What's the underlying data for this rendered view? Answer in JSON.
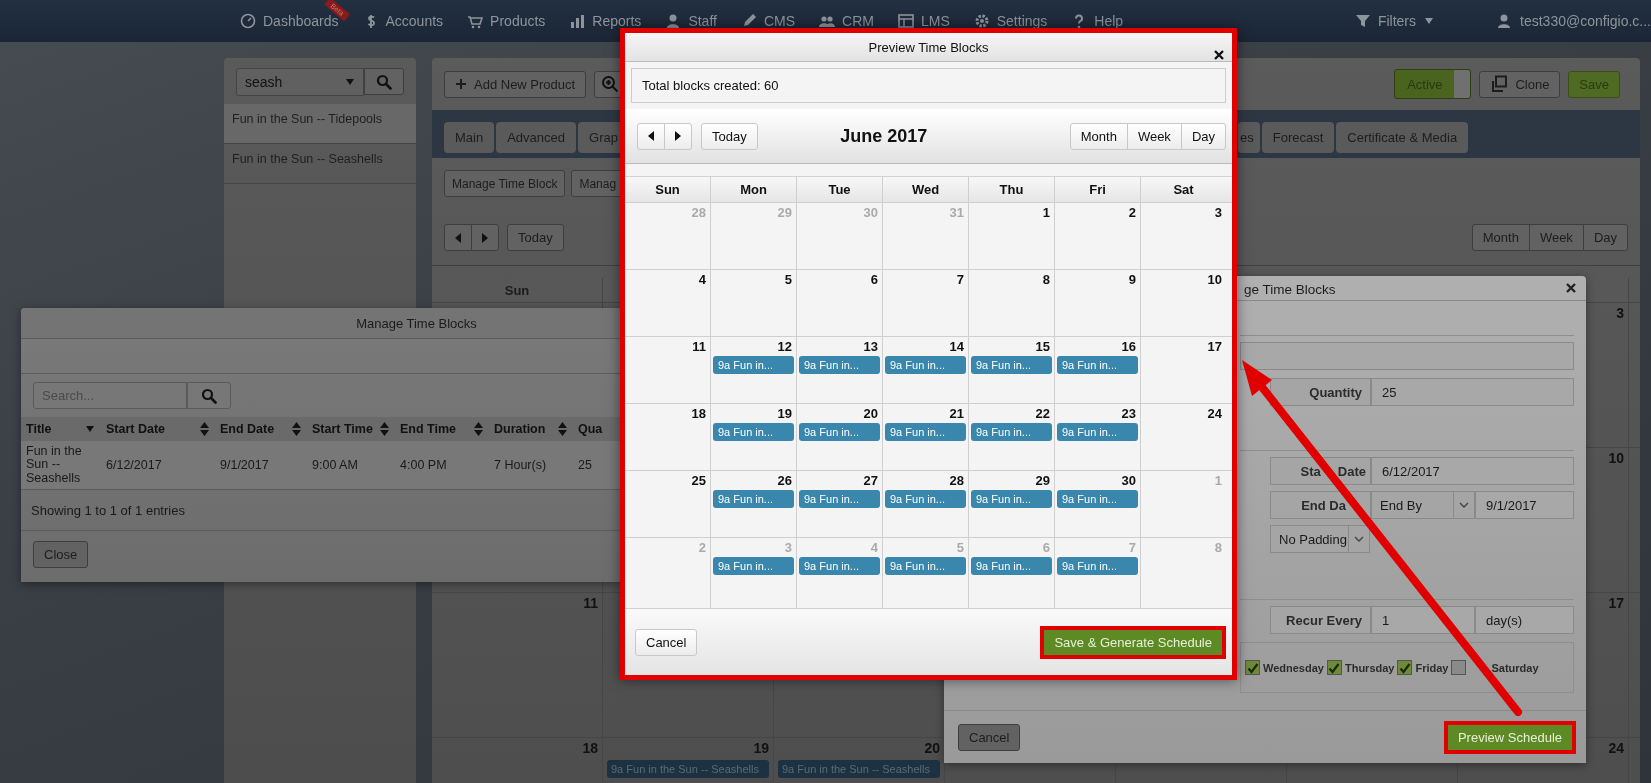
{
  "nav": {
    "items": [
      {
        "label": "Dashboards",
        "badge": "Beta"
      },
      {
        "label": "Accounts"
      },
      {
        "label": "Products"
      },
      {
        "label": "Reports"
      },
      {
        "label": "Staff"
      },
      {
        "label": "CMS"
      },
      {
        "label": "CRM"
      },
      {
        "label": "LMS"
      },
      {
        "label": "Settings"
      },
      {
        "label": "Help"
      }
    ],
    "filters": "Filters",
    "user": "test330@configio.c..."
  },
  "product_list": {
    "search_value": "seash",
    "items": [
      {
        "label": "Fun in the Sun -- Tidepools",
        "selected": true
      },
      {
        "label": "Fun in the Sun -- Seashells",
        "selected": false
      }
    ]
  },
  "toolbar": {
    "add_button": "Add New Product",
    "active_toggle": {
      "label": "Active",
      "on": true
    },
    "clone_button": "Clone",
    "save_button": "Save"
  },
  "tabs_left": [
    {
      "label": "Main"
    },
    {
      "label": "Advanced"
    },
    {
      "label": "Grap"
    }
  ],
  "tabs_right": [
    {
      "label": "es"
    },
    {
      "label": "Forecast"
    },
    {
      "label": "Certificate & Media"
    }
  ],
  "sub_buttons": [
    "Manage Time Block",
    "Manag"
  ],
  "calendar_toolbar": {
    "today": "Today",
    "views": [
      {
        "label": "Month"
      },
      {
        "label": "Week"
      },
      {
        "label": "Day"
      }
    ]
  },
  "calendar": {
    "header": {
      "sun": "Sun"
    },
    "weeks": [
      {
        "sat": {
          "day": "3"
        }
      },
      {
        "sat": {
          "day": "10"
        }
      },
      {
        "sun": {
          "day": "11"
        },
        "sat": {
          "day": "17"
        }
      },
      {
        "sun": {
          "day": "18"
        },
        "mon": {
          "day": "19",
          "events": [
            "9a Fun in the Sun -- Seashells"
          ]
        },
        "tue": {
          "day": "20",
          "events": [
            "9a Fun in the Sun -- Seashells"
          ]
        },
        "sat": {
          "day": "24"
        }
      }
    ]
  },
  "manage_dialog_left": {
    "title": "Manage Time Blocks",
    "search_placeholder": "Search...",
    "columns": [
      {
        "label": "Title",
        "sorted": true
      },
      {
        "label": "Start Date",
        "sorted": false
      },
      {
        "label": "End Date",
        "sorted": false
      },
      {
        "label": "Start Time",
        "sorted": false
      },
      {
        "label": "End Time",
        "sorted": false
      },
      {
        "label": "Duration",
        "sorted": false
      },
      {
        "label": "Qua"
      }
    ],
    "rows": [
      [
        "Fun in the Sun -- Seashells",
        "6/12/2017",
        "9/1/2017",
        "9:00 AM",
        "4:00 PM",
        "7 Hour(s)",
        "25"
      ]
    ],
    "info": "Showing 1 to 1 of 1 entries",
    "close_button": "Close"
  },
  "manage_dialog_right": {
    "title": "ge Time Blocks",
    "quantity_label": "Quantity",
    "quantity": "25",
    "start_label": [
      "Sta",
      "Date"
    ],
    "start_date": "6/12/2017",
    "end_label": "End Da",
    "end_mode": "End By",
    "end_date": "9/1/2017",
    "padding": "No Padding",
    "recur_label": "Recur Every",
    "recur_value": "1",
    "recur_unit": "day(s)",
    "days": [
      {
        "label": "Wednesday",
        "checked": true
      },
      {
        "label": "Thursday",
        "checked": true
      },
      {
        "label": "Friday",
        "checked": true
      },
      {
        "label": "Saturday",
        "checked": false
      }
    ],
    "cancel_button": "Cancel",
    "preview_button": "Preview Schedule"
  },
  "preview_dialog": {
    "title": "Preview Time Blocks",
    "total": "Total blocks created: 60",
    "today": "Today",
    "month_title": "June 2017",
    "views": [
      {
        "label": "Month"
      },
      {
        "label": "Week"
      },
      {
        "label": "Day"
      }
    ],
    "weekdays": [
      "Sun",
      "Mon",
      "Tue",
      "Wed",
      "Thu",
      "Fri",
      "Sat"
    ],
    "weeks": [
      [
        {
          "day": "28",
          "other_month": true
        },
        {
          "day": "29",
          "other_month": true
        },
        {
          "day": "30",
          "other_month": true
        },
        {
          "day": "31",
          "other_month": true
        },
        {
          "day": "1",
          "other_month": false
        },
        {
          "day": "2",
          "other_month": false
        },
        {
          "day": "3",
          "other_month": false
        }
      ],
      [
        {
          "day": "4",
          "other_month": false
        },
        {
          "day": "5",
          "other_month": false
        },
        {
          "day": "6",
          "other_month": false
        },
        {
          "day": "7",
          "other_month": false
        },
        {
          "day": "8",
          "other_month": false
        },
        {
          "day": "9",
          "other_month": false
        },
        {
          "day": "10",
          "other_month": false
        }
      ],
      [
        {
          "day": "11",
          "other_month": false
        },
        {
          "day": "12",
          "other_month": false,
          "events": [
            "9a Fun in..."
          ]
        },
        {
          "day": "13",
          "other_month": false,
          "events": [
            "9a Fun in..."
          ]
        },
        {
          "day": "14",
          "other_month": false,
          "events": [
            "9a Fun in..."
          ]
        },
        {
          "day": "15",
          "other_month": false,
          "events": [
            "9a Fun in..."
          ]
        },
        {
          "day": "16",
          "other_month": false,
          "events": [
            "9a Fun in..."
          ]
        },
        {
          "day": "17",
          "other_month": false
        }
      ],
      [
        {
          "day": "18",
          "other_month": false
        },
        {
          "day": "19",
          "other_month": false,
          "events": [
            "9a Fun in..."
          ]
        },
        {
          "day": "20",
          "other_month": false,
          "events": [
            "9a Fun in..."
          ]
        },
        {
          "day": "21",
          "other_month": false,
          "events": [
            "9a Fun in..."
          ]
        },
        {
          "day": "22",
          "other_month": false,
          "events": [
            "9a Fun in..."
          ]
        },
        {
          "day": "23",
          "other_month": false,
          "events": [
            "9a Fun in..."
          ]
        },
        {
          "day": "24",
          "other_month": false
        }
      ],
      [
        {
          "day": "25",
          "other_month": false
        },
        {
          "day": "26",
          "other_month": false,
          "events": [
            "9a Fun in..."
          ]
        },
        {
          "day": "27",
          "other_month": false,
          "events": [
            "9a Fun in..."
          ]
        },
        {
          "day": "28",
          "other_month": false,
          "events": [
            "9a Fun in..."
          ]
        },
        {
          "day": "29",
          "other_month": false,
          "events": [
            "9a Fun in..."
          ]
        },
        {
          "day": "30",
          "other_month": false,
          "events": [
            "9a Fun in..."
          ]
        },
        {
          "day": "1",
          "other_month": true
        }
      ],
      [
        {
          "day": "2",
          "other_month": true
        },
        {
          "day": "3",
          "other_month": true,
          "events": [
            "9a Fun in..."
          ]
        },
        {
          "day": "4",
          "other_month": true,
          "events": [
            "9a Fun in..."
          ]
        },
        {
          "day": "5",
          "other_month": true,
          "events": [
            "9a Fun in..."
          ]
        },
        {
          "day": "6",
          "other_month": true,
          "events": [
            "9a Fun in..."
          ]
        },
        {
          "day": "7",
          "other_month": true,
          "events": [
            "9a Fun in..."
          ]
        },
        {
          "day": "8",
          "other_month": true
        }
      ]
    ],
    "cancel_button": "Cancel",
    "save_button": "Save & Generate Schedule"
  }
}
